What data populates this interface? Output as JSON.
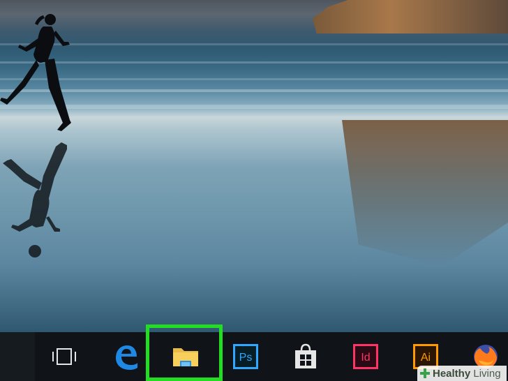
{
  "taskbar": {
    "items": [
      {
        "name": "task-view-icon"
      },
      {
        "name": "edge-icon"
      },
      {
        "name": "file-explorer-icon"
      },
      {
        "name": "photoshop-icon",
        "label": "Ps",
        "color": "#31a8ff"
      },
      {
        "name": "store-icon"
      },
      {
        "name": "indesign-icon",
        "label": "Id",
        "color": "#ff3366"
      },
      {
        "name": "illustrator-icon",
        "label": "Ai",
        "color": "#ff9a00"
      },
      {
        "name": "firefox-icon"
      }
    ],
    "highlight_color": "#22dd22"
  },
  "watermark": {
    "bold": "Healthy",
    "light": "Living"
  }
}
